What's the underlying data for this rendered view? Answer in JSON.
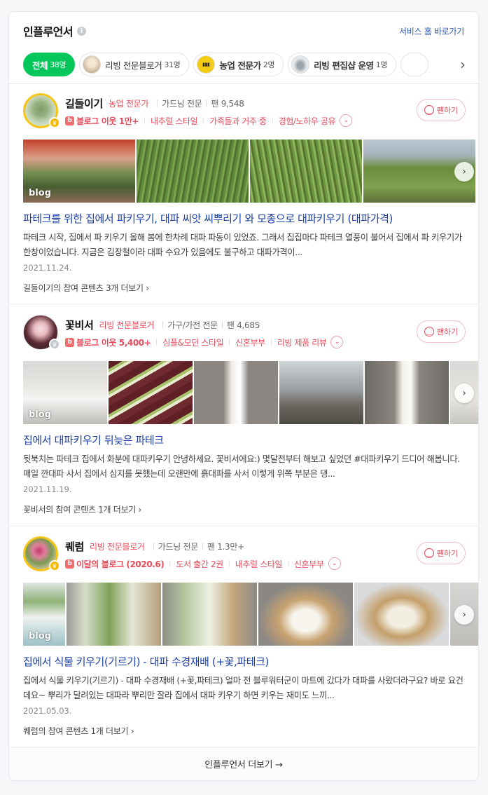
{
  "header": {
    "title": "인플루언서",
    "info_icon": "i",
    "home_link": "서비스 홈 바로가기"
  },
  "filters": [
    {
      "label": "전체",
      "count": "38명",
      "active": true
    },
    {
      "label": "리빙 전문블로거",
      "count": "31명",
      "icon": "avatar-living-icon"
    },
    {
      "label": "농업 전문가",
      "count": "2명",
      "icon": "avatar-farm-icon"
    },
    {
      "label": "리빙 편집샵 운영",
      "count": "1명",
      "icon": "avatar-shop-icon"
    }
  ],
  "entries": [
    {
      "name": "길들이기",
      "type": "농업 전문가",
      "specialty": "가드닝 전문",
      "fans": "팬 9,548",
      "tags": [
        "블로그 이웃 1만+",
        "내추럴 스타일",
        "가족들과 거주 중",
        "경험/노하우 공유"
      ],
      "fan_button": "팬하기",
      "blog_label": "blog",
      "title": "파테크를 위한 집에서 파키우기, 대파 씨앗 씨뿌리기 와 모종으로 대파키우기 (대파가격)",
      "desc": "파테크 시작, 집에서 파 키우기 올해 봄에 한차례 대파 파동이 있었죠. 그래서 집집마다 파테크 열풍이 불어서 집에서 파 키우기가 한창이었습니다. 지금은 김장철이라 대파 수요가 있음에도 불구하고 대파가격이...",
      "date": "2021.11.24.",
      "more": "길들이기의 참여 콘텐츠 3개 더보기"
    },
    {
      "name": "꽃비서",
      "type": "리빙 전문블로거",
      "specialty": "가구/가전 전문",
      "fans": "팬 4,685",
      "tags": [
        "블로그 이웃 5,400+",
        "심플&모던 스타일",
        "신혼부부",
        "리빙 제품 리뷰"
      ],
      "fan_button": "팬하기",
      "blog_label": "blog",
      "title": "집에서 대파키우기 뒤늦은 파테크",
      "desc": "뒷북치는 파테크 집에서 화분에 대파키우기 안녕하세요. 꽃비서에요:) 몇달전부터 해보고 싶었던 #대파키우기 드디어 해봅니다. 매일 깐대파 사서 집에서 심지를 못했는데 오랜만에 흙대파를 사서 이렇게 위쪽 부분은 댕...",
      "date": "2021.11.19.",
      "more": "꽃비서의 참여 콘텐츠 1개 더보기"
    },
    {
      "name": "퀘럼",
      "type": "리빙 전문블로거",
      "specialty": "가드닝 전문",
      "fans": "팬 1.3만+",
      "tags": [
        "이달의 블로그 (2020.6)",
        "도서 출간 2권",
        "내추럴 스타일",
        "신혼부부"
      ],
      "fan_button": "팬하기",
      "blog_label": "blog",
      "title": "집에서 식물 키우기(기르기) - 대파 수경재배 (+꽃,파테크)",
      "desc": "집에서 식물 키우기(기르기) - 대파 수경재배 (+꽃,파테크) 얼마 전 블루워터군이 마트에 갔다가 대파를 사왔더라구요? 바로 요건데요~ 뿌리가 달려있는 대파라 뿌리만 잘라 집에서 대파 키우기 하면 키우는 재미도 느끼...",
      "date": "2021.05.03.",
      "more": "퀘럼의 참여 콘텐츠 1개 더보기"
    }
  ],
  "footer": {
    "label": "인플루언서 더보기 →"
  }
}
